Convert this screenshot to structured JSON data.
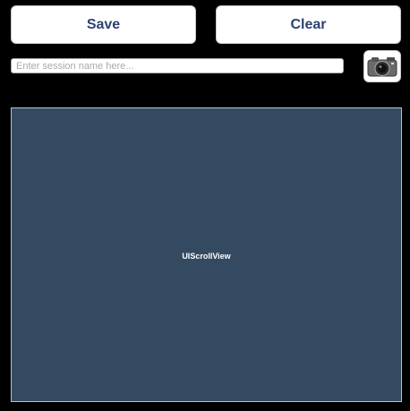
{
  "toolbar": {
    "save_label": "Save",
    "clear_label": "Clear"
  },
  "session": {
    "value": "",
    "placeholder": "Enter session name here..."
  },
  "camera": {
    "icon": "camera-icon"
  },
  "scroll_view": {
    "label": "UIScrollView"
  },
  "colors": {
    "background": "#000000",
    "button_text": "#2d4270",
    "scroll_view_fill": "#344a61"
  }
}
